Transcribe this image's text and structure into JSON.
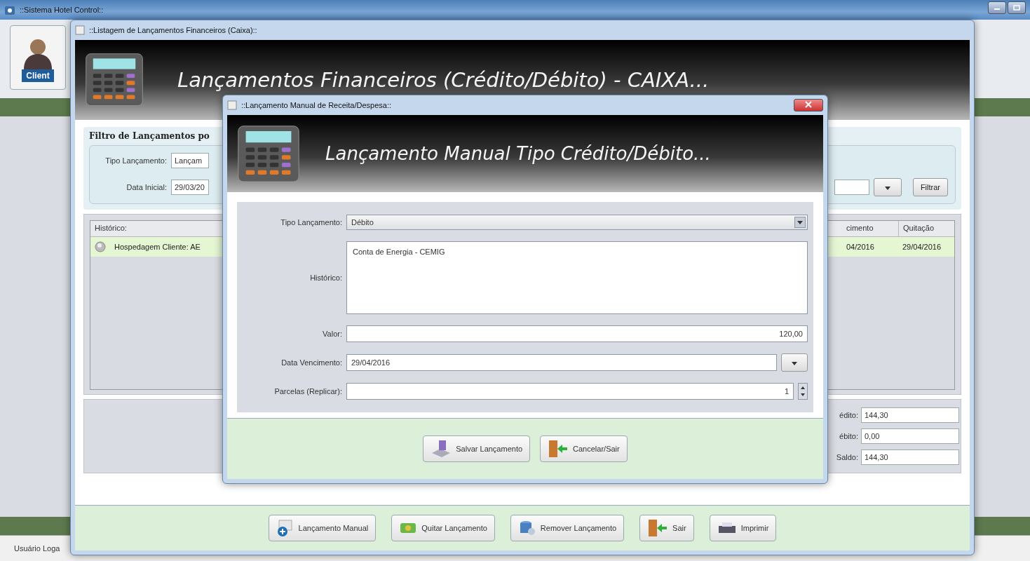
{
  "app": {
    "title": "::Sistema Hotel Control::",
    "sidebar_button": "Client",
    "status_user": "Usuário Loga"
  },
  "list_window": {
    "title": "::Listagem de Lançamentos Financeiros (Caixa)::",
    "heading": "Lançamentos Financeiros (Crédito/Débito) - CAIXA...",
    "filter": {
      "title": "Filtro de Lançamentos po",
      "type_label": "Tipo Lançamento:",
      "type_value": "Lançam",
      "start_label": "Data Inicial:",
      "start_value": "29/03/20",
      "button": "Filtrar"
    },
    "table": {
      "columns": [
        "Histórico:",
        "cimento",
        "Quitação"
      ],
      "rows": [
        {
          "cells": [
            "Hospedagem Cliente: AE",
            "04/2016",
            "29/04/2016"
          ],
          "selected": true
        }
      ]
    },
    "totals": [
      {
        "label": "édito:",
        "value": "144,30"
      },
      {
        "label": "ébito:",
        "value": "0,00"
      },
      {
        "label": "Saldo:",
        "value": "144,30"
      }
    ],
    "buttons": [
      {
        "label": "Lançamento Manual",
        "kind": "add"
      },
      {
        "label": "Quitar Lançamento",
        "kind": "money"
      },
      {
        "label": "Remover Lançamento",
        "kind": "remove"
      },
      {
        "label": "Sair",
        "kind": "exit"
      },
      {
        "label": "Imprimir",
        "kind": "print"
      }
    ]
  },
  "dialog": {
    "title": "::Lançamento Manual de Receita/Despesa::",
    "heading": "Lançamento Manual Tipo Crédito/Débito...",
    "fields": [
      {
        "kind": "select",
        "label": "Tipo Lançamento:",
        "value": "Débito"
      },
      {
        "kind": "textarea",
        "label": "Histórico:",
        "value": "Conta de Energia - CEMIG"
      },
      {
        "kind": "text",
        "label": "Valor:",
        "value": "120,00"
      },
      {
        "kind": "date",
        "label": "Data Vencimento:",
        "value": "29/04/2016"
      },
      {
        "kind": "spinner",
        "label": "Parcelas (Replicar):",
        "value": "1"
      }
    ],
    "buttons": [
      {
        "label": "Salvar Lançamento",
        "kind": "save"
      },
      {
        "label": "Cancelar/Sair",
        "kind": "exit"
      }
    ]
  }
}
